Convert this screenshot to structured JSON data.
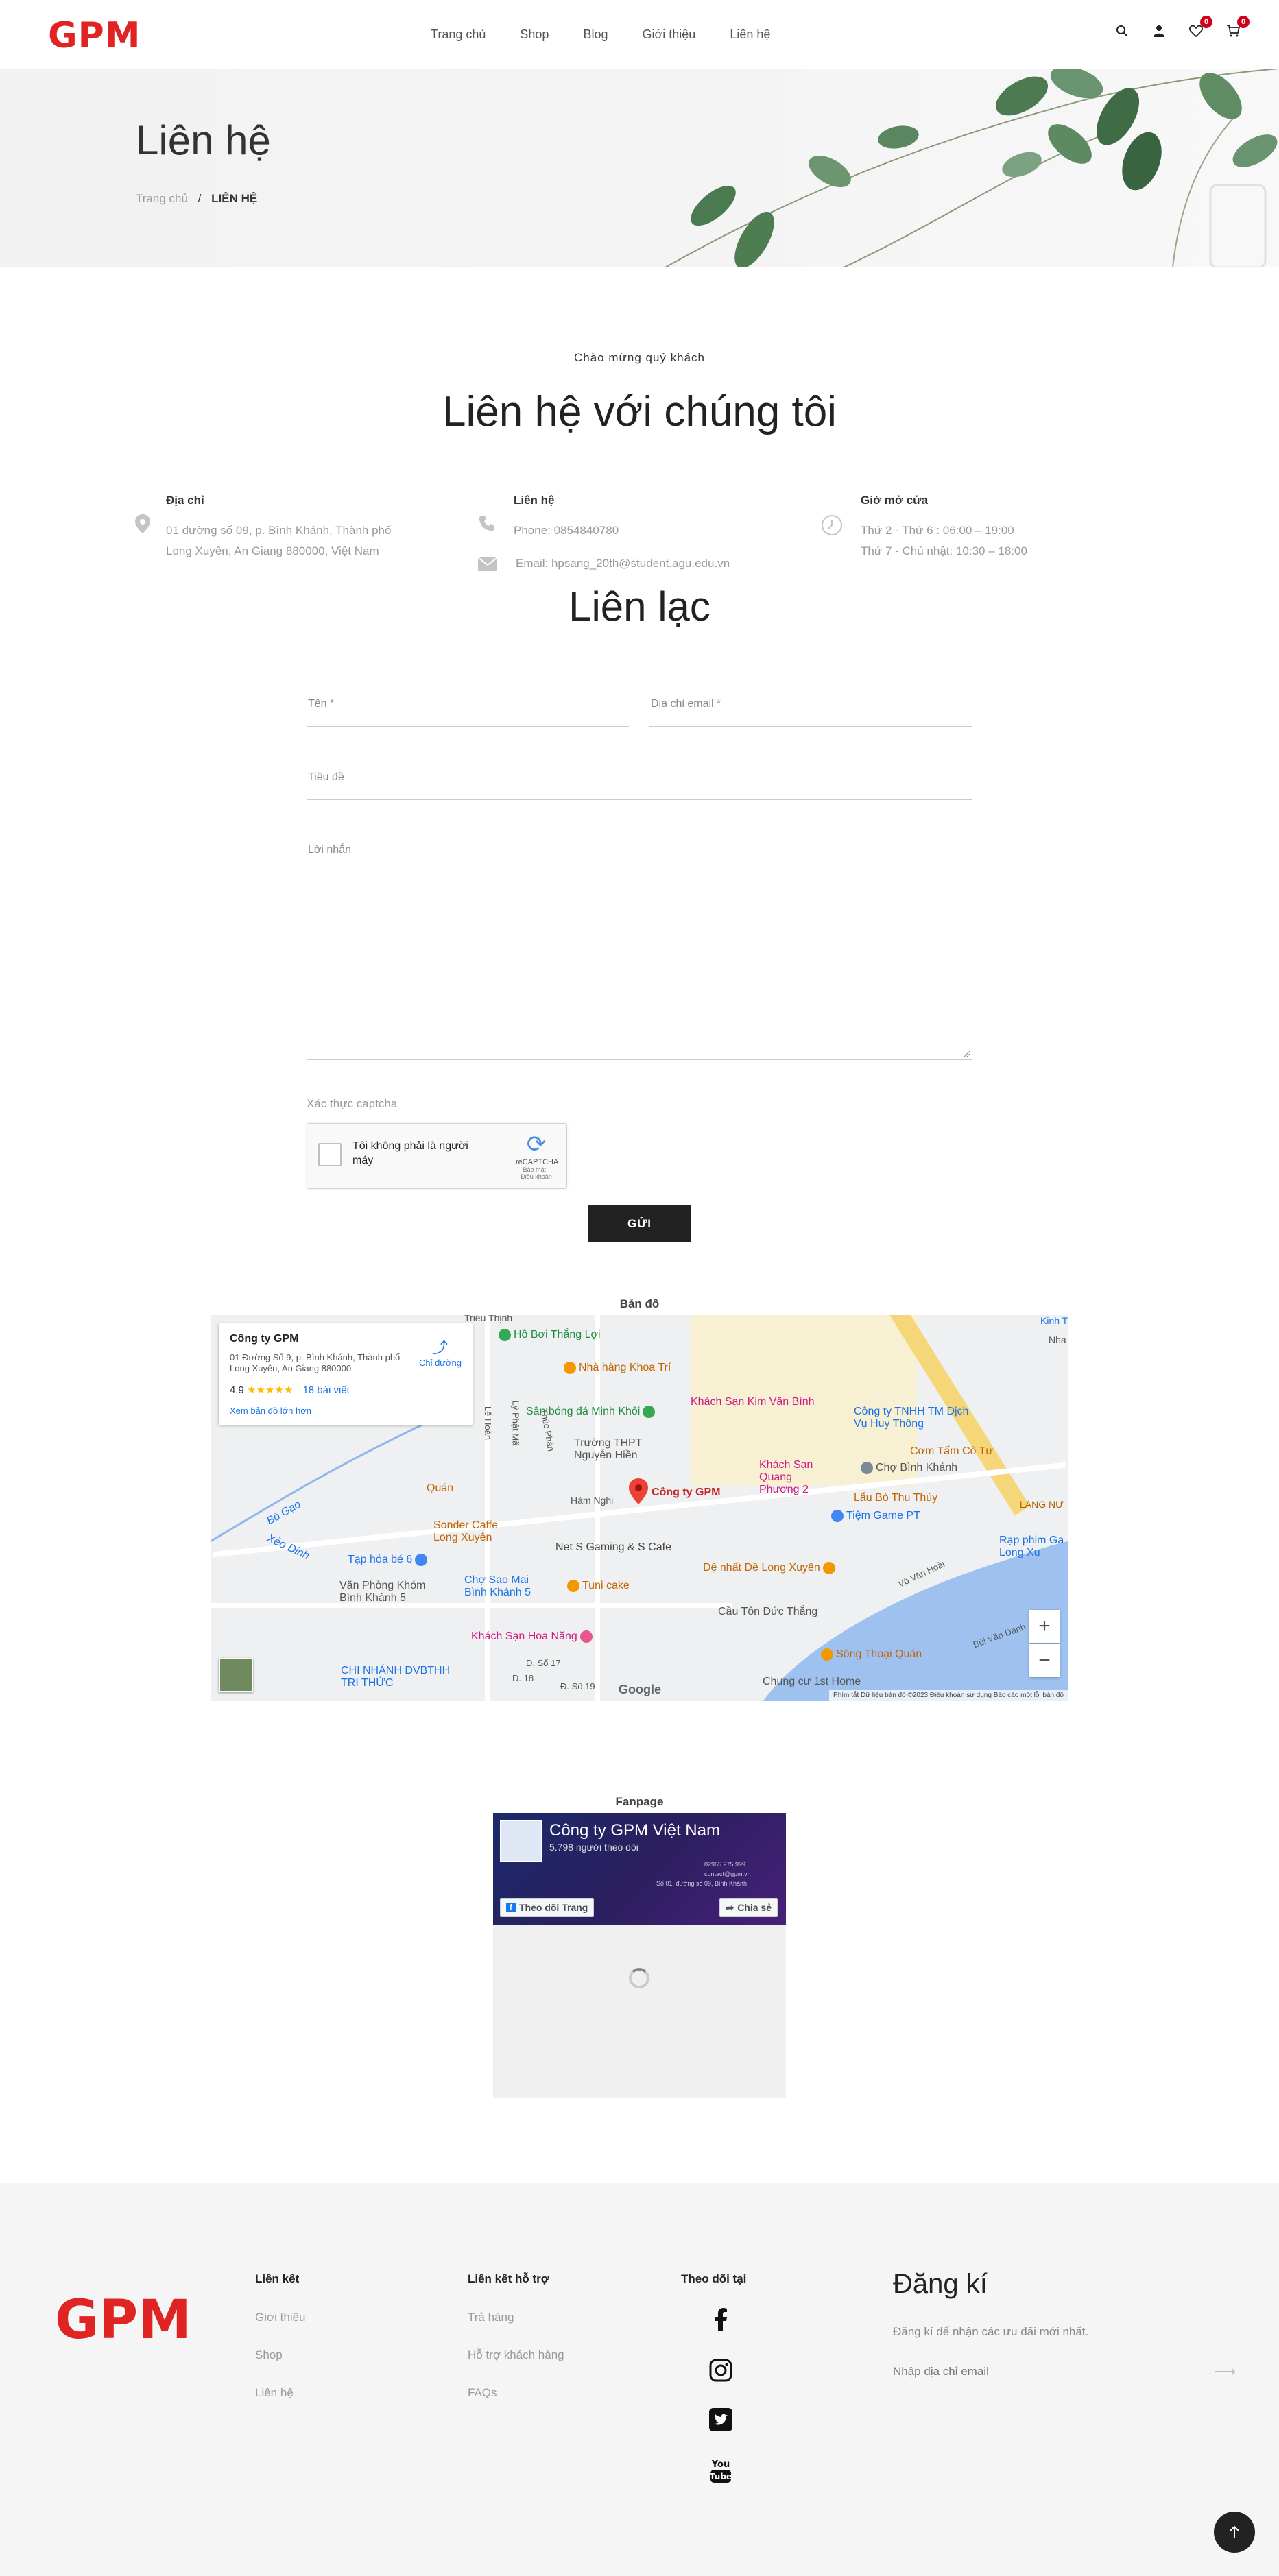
{
  "header": {
    "logo": "GPM",
    "nav": [
      "Trang chủ",
      "Shop",
      "Blog",
      "Giới thiệu",
      "Liên hệ"
    ],
    "wishlist_count": "0",
    "cart_count": "0"
  },
  "banner": {
    "title": "Liên hệ",
    "breadcrumb_home": "Trang chủ",
    "breadcrumb_sep": "/",
    "breadcrumb_current": "LIÊN HỆ"
  },
  "intro": {
    "welcome": "Chào mừng quý khách",
    "title": "Liên hệ với chúng tôi"
  },
  "info": {
    "address": {
      "title": "Địa chỉ",
      "line1": "01 đường số 09, p. Bình Khánh, Thành phố",
      "line2": "Long Xuyên, An Giang 880000, Việt Nam"
    },
    "contact": {
      "title": "Liên hệ",
      "phone": "Phone: 0854840780",
      "email": "Email: hpsang_20th@student.agu.edu.vn"
    },
    "hours": {
      "title": "Giờ mở cửa",
      "line1": "Thứ 2 - Thứ 6 : 06:00 – 19:00",
      "line2": "Thứ 7 - Chủ nhật: 10:30 – 18:00"
    }
  },
  "form": {
    "title": "Liên lạc",
    "name_label": "Tên *",
    "email_label": "Địa chỉ email *",
    "subject_label": "Tiêu đề",
    "message_label": "Lời nhắn",
    "captcha_label": "Xác thực captcha",
    "recaptcha_text": "Tôi không phải là người máy",
    "recaptcha_brand": "reCAPTCHA",
    "recaptcha_terms": "Bảo mật - Điều khoản",
    "submit": "GỬI"
  },
  "map": {
    "section_label": "Bản đồ",
    "place_name": "Công ty GPM",
    "place_address": "01 Đường Số 9, p. Bình Khánh, Thành phố Long Xuyên, An Giang 880000",
    "rating": "4,9",
    "stars": "★★★★★",
    "reviews": "18 bài viết",
    "larger_map": "Xem bản đồ lớn hơn",
    "directions": "Chỉ đường",
    "pin_label": "Công ty GPM",
    "google": "Google",
    "footer_text": "Phím tắt   Dữ liệu bản đồ ©2023   Điều khoản sử dụng   Báo cáo một lỗi bản đồ",
    "zoom_in": "+",
    "zoom_out": "−",
    "pois": [
      "Triều Thịnh",
      "Hồ Bơi Thắng Lợi",
      "Nhà hàng Khoa Trí",
      "Sân bóng đá Minh Khôi",
      "Khách Sạn Kim Văn Bình",
      "Công ty TNHH TM Dịch Vụ Huy Thông",
      "Trường THPT Nguyễn Hiền",
      "Khách Sạn Quang Phương 2",
      "Cơm Tấm Cô Tư",
      "Chợ Bình Khánh",
      "Lẩu Bò Thu Thủy",
      "Quán",
      "Tiệm Game PT",
      "Sonder Caffe Long Xuyên",
      "Net S Gaming & S Cafe",
      "Rạp phim Ga Long Xu",
      "Tạp hóa bé 6",
      "Đệ nhất Dê Long Xuyên",
      "Văn Phòng Khóm Bình Khánh 5",
      "Chợ Sao Mai Bình Khánh 5",
      "Tuni cake",
      "Cầu Tôn Đức Thắng",
      "Khách Sạn Hoa Năng",
      "Sông Thoại Quán",
      "CHI NHÁNH DVBTHH TRI THỨC",
      "Chung cư 1st Home",
      "Xẻo Dinh",
      "Bò Gạo",
      "Hàm Nghi",
      "Lê Hoàn",
      "Lý Phật Mã",
      "Thúc Phán",
      "Đ. Số 17",
      "Đ. 18",
      "Đ. Số 19",
      "Vô Văn Hoài",
      "Bùi Văn Danh",
      "Kinh T",
      "Nha",
      "LÀNG NƯ"
    ]
  },
  "fanpage": {
    "section_label": "Fanpage",
    "page_name": "Công ty GPM Việt Nam",
    "followers": "5.798 người theo dõi",
    "follow_btn": "Theo dõi Trang",
    "share_btn": "Chia sẻ",
    "cover_phone": "02965 275 999",
    "cover_email": "contact@gpm.vn",
    "cover_address": "Số 01, đường số 09, Bình Khánh"
  },
  "footer": {
    "logo": "GPM",
    "col1_title": "Liên kết",
    "col1_links": [
      "Giới thiệu",
      "Shop",
      "Liên hệ"
    ],
    "col2_title": "Liên kết hỗ trợ",
    "col2_links": [
      "Trả hàng",
      "Hỗ trợ khách hàng",
      "FAQs"
    ],
    "col3_title": "Theo dõi tại",
    "social_icons": [
      "facebook-icon",
      "instagram-icon",
      "twitter-icon",
      "youtube-icon"
    ],
    "subscribe_title": "Đăng kí",
    "subscribe_desc": "Đăng kí để nhận các ưu đãi mới nhất.",
    "email_placeholder": "Nhập địa chỉ email"
  },
  "colors": {
    "brand": "#e02424",
    "dark": "#222222",
    "badge": "#d0021b"
  }
}
